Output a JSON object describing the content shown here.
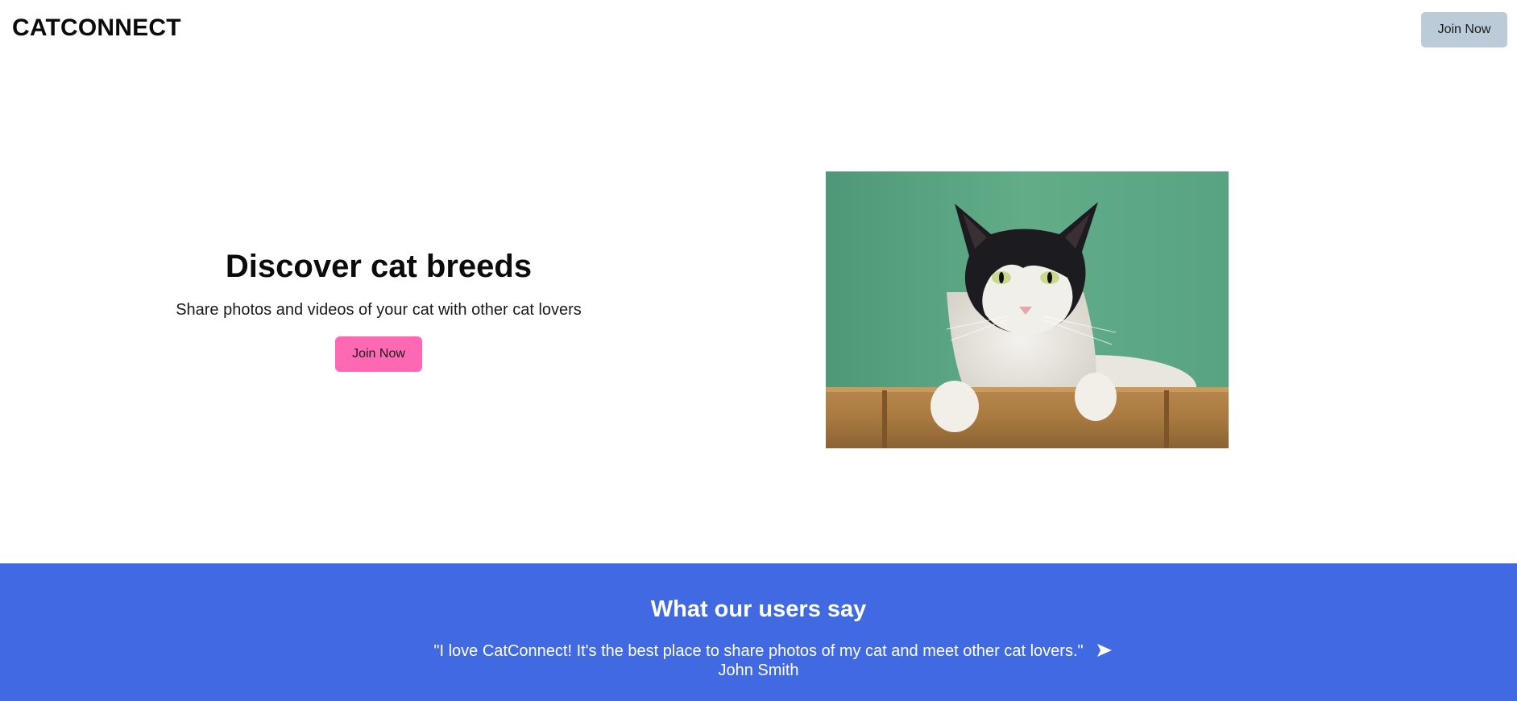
{
  "header": {
    "brand": "CATCONNECT",
    "join_label": "Join Now"
  },
  "hero": {
    "title": "Discover cat breeds",
    "subtitle": "Share photos and videos of your cat with other cat lovers",
    "join_label": "Join Now"
  },
  "testimonials": {
    "title": "What our users say",
    "quote": "\"I love CatConnect! It's the best place to share photos of my cat and meet other cat lovers.\"",
    "author": "John Smith",
    "next_icon": "arrow-right-icon"
  },
  "colors": {
    "header_button": "#bccbd8",
    "hero_button": "#ff69b4",
    "testimonials_bg": "#4169e1"
  }
}
